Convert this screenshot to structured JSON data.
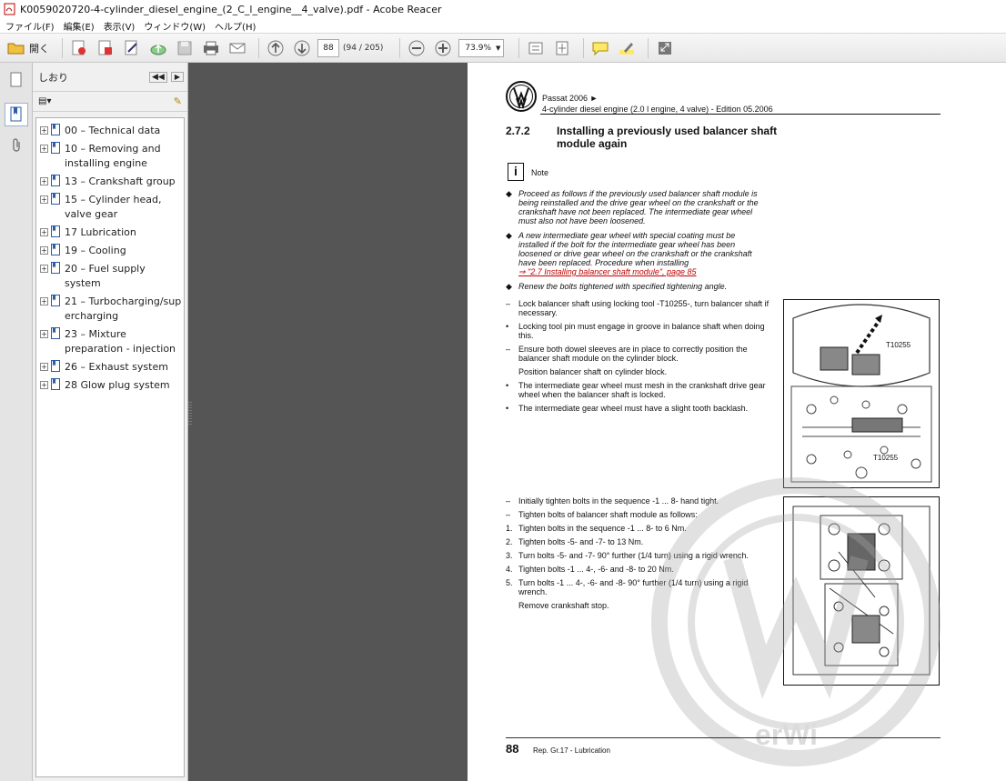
{
  "window": {
    "title": "K0059020720-4-cylinder_diesel_engine_(2_C_l_engine__4_valve).pdf - Acobe Reacer"
  },
  "menu": [
    "ファイル(F)",
    "編集(E)",
    "表示(V)",
    "ウィンドウ(W)",
    "ヘルプ(H)"
  ],
  "toolbar": {
    "open_label": "開く",
    "page_value": "88",
    "page_count": "(94 / 205)",
    "zoom_value": "73.9%"
  },
  "sidebar": {
    "title": "しおり",
    "bookmarks": [
      {
        "label": "00 – Technical data"
      },
      {
        "label": "10 – Removing and installing engine"
      },
      {
        "label": "13 – Crankshaft group"
      },
      {
        "label": "15 – Cylinder head, valve gear"
      },
      {
        "label": "17    Lubrication"
      },
      {
        "label": "19 – Cooling"
      },
      {
        "label": "20 – Fuel supply system"
      },
      {
        "label": "21 – Turbocharging/supercharging"
      },
      {
        "label": "23 – Mixture preparation - injection"
      },
      {
        "label": "26 – Exhaust system"
      },
      {
        "label": "28    Glow plug system"
      }
    ]
  },
  "page": {
    "header_line1": "Passat 2006 ►",
    "header_line2": "4-cylinder diesel engine (2.0 l engine, 4 valve) - Edition 05.2006",
    "section_number": "2.7.2",
    "section_title": "Installing a previously used balancer shaft module again",
    "note_icon": "i",
    "note_label": "Note",
    "notes": [
      "Proceed as follows if the previously used balancer shaft module is being reinstalled and the drive gear wheel on the crankshaft or the crankshaft have not been replaced. The intermediate gear wheel must also not have been loosened.",
      "A new intermediate gear wheel with special coating must be installed if the bolt for the intermediate gear wheel has been loosened or drive gear wheel on the crankshaft or the crankshaft have been replaced. Procedure when installing",
      "Renew the bolts tightened with specified tightening angle."
    ],
    "note_link": "⇒ \"2.7 Installing balancer shaft module\", page 85",
    "steps1": [
      {
        "m": "–",
        "t": "Lock balancer shaft using locking tool -T10255-, turn balancer shaft if necessary."
      },
      {
        "m": "•",
        "t": "Locking tool pin must engage in groove in balance shaft when doing this."
      },
      {
        "m": "–",
        "t": "Ensure both dowel sleeves are in place to correctly position the balancer shaft module on the cylinder block."
      },
      {
        "m": "",
        "t": "Position balancer shaft on cylinder block."
      },
      {
        "m": "•",
        "t": "The intermediate gear wheel must mesh in the crankshaft drive gear wheel when the balancer shaft is locked."
      },
      {
        "m": "•",
        "t": "The intermediate gear wheel must have a slight tooth backlash."
      }
    ],
    "steps2": [
      {
        "m": "–",
        "t": "Initially tighten bolts in the sequence -1 ... 8- hand tight."
      },
      {
        "m": "–",
        "t": "Tighten bolts of balancer shaft module as follows:"
      },
      {
        "m": "1.",
        "t": "Tighten bolts in the sequence -1 ... 8- to 6 Nm."
      },
      {
        "m": "2.",
        "t": "Tighten bolts -5- and -7- to 13 Nm."
      },
      {
        "m": "3.",
        "t": "Turn bolts -5- and -7- 90° further (1/4 turn) using a rigid wrench."
      },
      {
        "m": "4.",
        "t": "Tighten bolts -1 ... 4-, -6- and -8- to 20 Nm."
      },
      {
        "m": "5.",
        "t": "Turn bolts -1 ... 4-, -6- and -8- 90° further (1/4 turn) using a rigid wrench."
      },
      {
        "m": "",
        "t": "Remove crankshaft stop."
      }
    ],
    "fig1_label_a": "T10255",
    "fig1_label_b": "T10255",
    "page_number": "88",
    "footer_text": "Rep. Gr.17 - Lubrication",
    "watermark_text": "erWi"
  },
  "colors": {
    "gray": "#555555",
    "link_red": "#c00000"
  }
}
